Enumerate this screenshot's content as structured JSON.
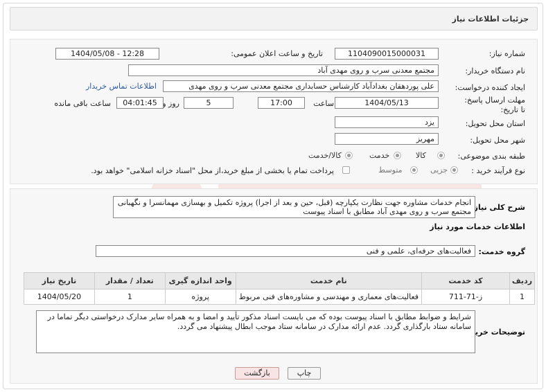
{
  "header": {
    "title": "جزئیات اطلاعات نیاز"
  },
  "fields": {
    "need_number_label": "شماره نیاز:",
    "need_number": "1104090015000031",
    "announce_label": "تاریخ و ساعت اعلان عمومی:",
    "announce_value": "1404/05/08 - 12:28",
    "buyer_org_label": "نام دستگاه خریدار:",
    "buyer_org": "مجتمع معدنی سرب و روی مهدی آباد",
    "creator_label": "ایجاد کننده درخواست:",
    "creator": "علی پوردهقان بغدادآباد کارشناس حسابداری مجتمع معدنی سرب و روی مهدی",
    "contact_link": "اطلاعات تماس خریدار",
    "deadline_label": "مهلت ارسال پاسخ: تا تاریخ:",
    "deadline_date": "1404/05/13",
    "time_label": "ساعت",
    "deadline_time": "17:00",
    "days": "5",
    "days_label": "روز و",
    "remaining_time": "04:01:45",
    "remaining_label": "ساعت باقی مانده",
    "province_label": "استان محل تحویل:",
    "province": "یزد",
    "city_label": "شهر محل تحویل:",
    "city": "مهریز",
    "category_label": "طبقه بندی موضوعی:",
    "category_options": [
      "کالا",
      "خدمت",
      "کالا/خدمت"
    ],
    "process_label": "نوع فرآیند خرید :",
    "process_options": [
      "جزیی",
      "متوسط"
    ],
    "payment_note": "پرداخت تمام یا بخشی از مبلغ خرید،از محل \"اسناد خزانه اسلامی\" خواهد بود."
  },
  "description": {
    "label": "شرح کلی نیاز:",
    "text": "انجام خدمات مشاوره جهت نظارت یکپارچه (قبل، حین و بعد از اجرا) پروژه تکمیل و بهسازی مهمانسرا و نگهبانی مجتمع سرب و روی مهدی آباد مطابق با اسناد پیوست"
  },
  "services": {
    "section_title": "اطلاعات خدمات مورد نیاز",
    "group_label": "گروه خدمت:",
    "group_value": "فعالیت‌های حرفه‌ای، علمی و فنی",
    "columns": [
      "ردیف",
      "کد خدمت",
      "نام خدمت",
      "واحد اندازه گیری",
      "تعداد / مقدار",
      "تاریخ نیاز"
    ],
    "rows": [
      [
        "1",
        "ز-71-711",
        "فعالیت‌های معماری و مهندسی و مشاوره‌های فنی مربوط",
        "پروژه",
        "1",
        "1404/05/20"
      ]
    ]
  },
  "buyer_notes": {
    "label": "توضیحات خریدار:",
    "text": "شرایط و ضوابط مطابق با اسناد پیوست بوده که می بایست اسناد مذکور تأیید و امضا و به همراه سایر مدارک درخواستی دیگر تماما در سامانه ستاد بارگذاری گردد. عدم ارائه مدارک در سامانه ستاد موجب ابطال پیشنهاد می گردد."
  },
  "buttons": {
    "print": "چاپ",
    "back": "بازگشت"
  }
}
